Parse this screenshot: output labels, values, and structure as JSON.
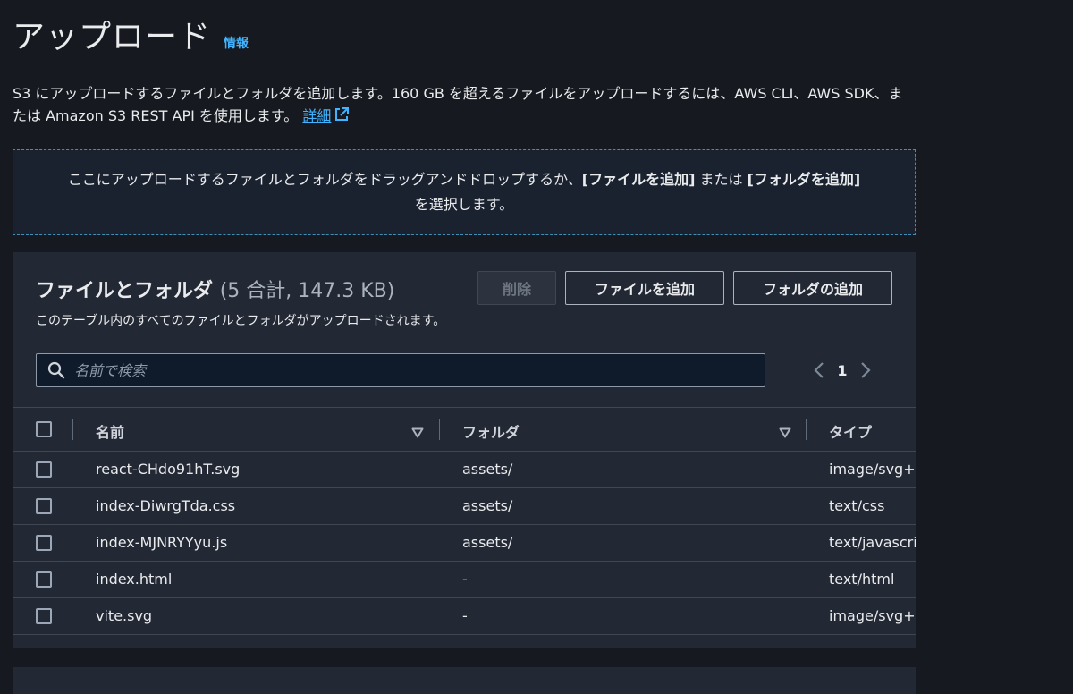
{
  "header": {
    "title": "アップロード",
    "info_link": "情報"
  },
  "description": {
    "text": "S3 にアップロードするファイルとフォルダを追加します。160 GB を超えるファイルをアップロードするには、AWS CLI、AWS SDK、または Amazon S3 REST API を使用します。",
    "more_link": "詳細"
  },
  "dropzone": {
    "part1": "ここにアップロードするファイルとフォルダをドラッグアンドドロップするか、",
    "add_files": "[ファイルを追加]",
    "or": " または ",
    "add_folder": "[フォルダを追加]",
    "part2": "を選択します。"
  },
  "files_panel": {
    "title": "ファイルとフォルダ",
    "count": "(5 合計, 147.3 KB)",
    "subtitle": "このテーブル内のすべてのファイルとフォルダがアップロードされます。",
    "buttons": {
      "delete": "削除",
      "add_files": "ファイルを追加",
      "add_folder": "フォルダの追加"
    },
    "search": {
      "placeholder": "名前で検索",
      "value": ""
    },
    "pagination": {
      "current_page": "1"
    },
    "columns": {
      "name": "名前",
      "folder": "フォルダ",
      "type": "タイプ"
    },
    "rows": [
      {
        "name": "react-CHdo91hT.svg",
        "folder": "assets/",
        "type": "image/svg+x"
      },
      {
        "name": "index-DiwrgTda.css",
        "folder": "assets/",
        "type": "text/css"
      },
      {
        "name": "index-MJNRYYyu.js",
        "folder": "assets/",
        "type": "text/javascri"
      },
      {
        "name": "index.html",
        "folder": "-",
        "type": "text/html"
      },
      {
        "name": "vite.svg",
        "folder": "-",
        "type": "image/svg+x"
      }
    ]
  },
  "colors": {
    "background": "#16191f",
    "panel": "#222834",
    "link": "#42b4ff",
    "dropzone_border": "#3f8fb7"
  },
  "icons": [
    "external-link-icon",
    "search-icon",
    "chevron-left-icon",
    "chevron-right-icon",
    "sort-down-icon"
  ]
}
